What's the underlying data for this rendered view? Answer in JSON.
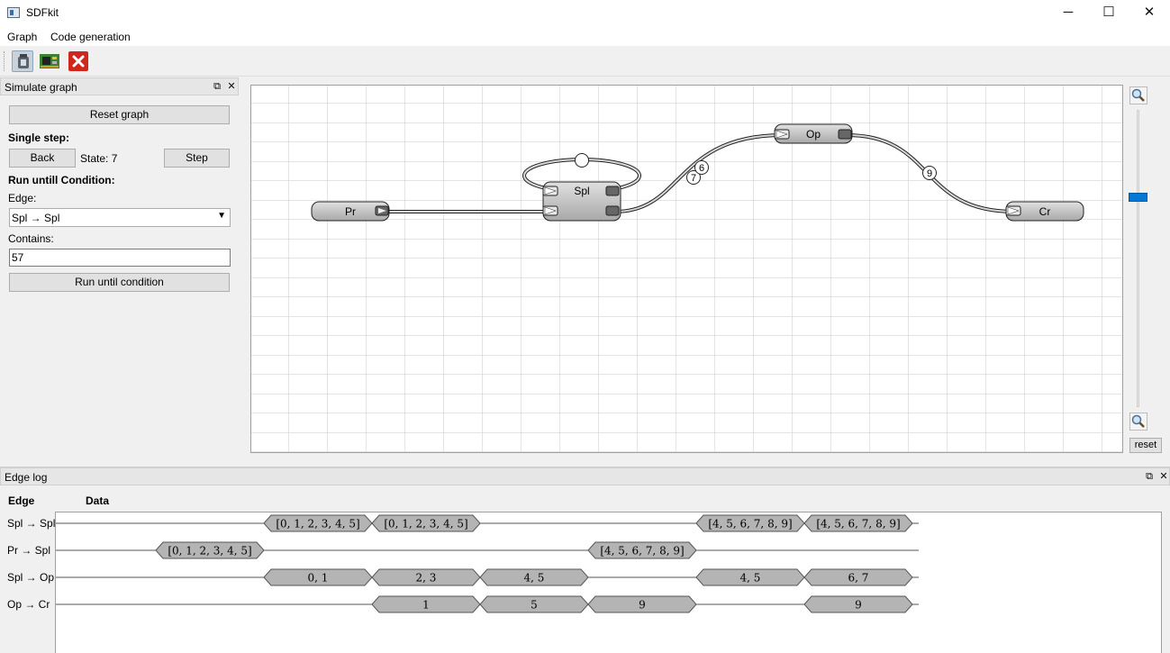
{
  "window": {
    "title": "SDFkit",
    "minimize_glyph": "─",
    "maximize_glyph": "☐",
    "close_glyph": "✕"
  },
  "menu": [
    "Graph",
    "Code generation"
  ],
  "toolbar": {
    "buttons": [
      {
        "icon": "simulate-icon",
        "color": "#9aa4ae"
      },
      {
        "icon": "chip-icon",
        "color": "#4b8b3b"
      },
      {
        "icon": "close-red-icon",
        "color": "#d0271d"
      }
    ]
  },
  "simulate_panel": {
    "title": "Simulate graph",
    "reset_label": "Reset graph",
    "single_step_label": "Single step:",
    "back_label": "Back",
    "state_text": "State: 7",
    "step_label": "Step",
    "run_until_label": "Run untill Condition:",
    "edge_label": "Edge:",
    "edge_value": "Spl → Spl",
    "contains_label": "Contains:",
    "contains_value": "57",
    "run_button_label": "Run until condition"
  },
  "graph": {
    "nodes": {
      "pr": "Pr",
      "spl": "Spl",
      "op": "Op",
      "cr": "Cr"
    },
    "edge_tokens": {
      "self_loop": "",
      "spl_op_a": "7",
      "spl_op_b": "6",
      "op_cr": "9"
    }
  },
  "zoom": {
    "reset_label": "reset",
    "level": 0.7
  },
  "edge_log": {
    "title": "Edge log",
    "col_edge": "Edge",
    "col_data": "Data",
    "rows": [
      {
        "edge": "Spl → Spl",
        "tokens": [
          {
            "text": "[0, 1, 2, 3, 4, 5]",
            "start": 2,
            "end": 3
          },
          {
            "text": "[0, 1, 2, 3, 4, 5]",
            "start": 3,
            "end": 4
          },
          {
            "text": "[4, 5, 6, 7, 8, 9]",
            "start": 6,
            "end": 7
          },
          {
            "text": "[4, 5, 6, 7, 8, 9]",
            "start": 7,
            "end": 8
          }
        ]
      },
      {
        "edge": "Pr → Spl",
        "tokens": [
          {
            "text": "[0, 1, 2, 3, 4, 5]",
            "start": 1,
            "end": 2
          },
          {
            "text": "[4, 5, 6, 7, 8, 9]",
            "start": 5,
            "end": 6
          }
        ]
      },
      {
        "edge": "Spl → Op",
        "tokens": [
          {
            "text": "0, 1",
            "start": 2,
            "end": 3
          },
          {
            "text": "2, 3",
            "start": 3,
            "end": 4
          },
          {
            "text": "4, 5",
            "start": 4,
            "end": 5
          },
          {
            "text": "4, 5",
            "start": 6,
            "end": 7
          },
          {
            "text": "6, 7",
            "start": 7,
            "end": 8
          }
        ]
      },
      {
        "edge": "Op → Cr",
        "tokens": [
          {
            "text": "1",
            "start": 3,
            "end": 4
          },
          {
            "text": "5",
            "start": 4,
            "end": 5
          },
          {
            "text": "9",
            "start": 5,
            "end": 6
          },
          {
            "text": "9",
            "start": 7,
            "end": 8
          }
        ]
      }
    ]
  }
}
